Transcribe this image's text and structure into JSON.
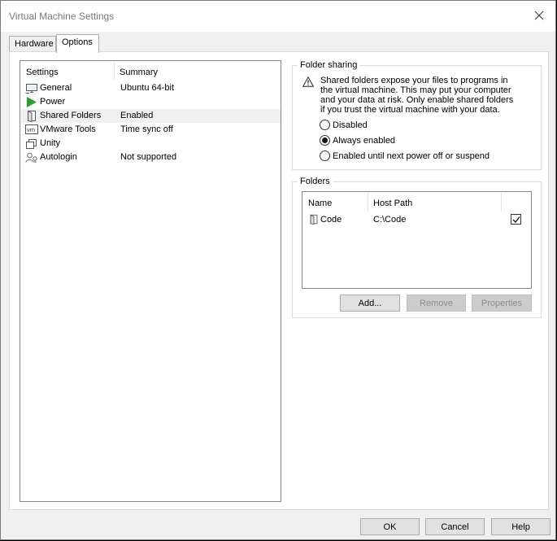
{
  "window": {
    "title": "Virtual Machine Settings"
  },
  "tabs": [
    {
      "label": "Hardware",
      "active": false
    },
    {
      "label": "Options",
      "active": true
    }
  ],
  "settings_list": {
    "headers": {
      "setting": "Settings",
      "summary": "Summary"
    },
    "rows": [
      {
        "icon": "monitor-icon",
        "label": "General",
        "summary": "Ubuntu 64-bit",
        "selected": false
      },
      {
        "icon": "power-play-icon",
        "label": "Power",
        "summary": "",
        "selected": false
      },
      {
        "icon": "shared-folder-icon",
        "label": "Shared Folders",
        "summary": "Enabled",
        "selected": true
      },
      {
        "icon": "vmware-tools-icon",
        "label": "VMware Tools",
        "summary": "Time sync off",
        "selected": false
      },
      {
        "icon": "unity-icon",
        "label": "Unity",
        "summary": "",
        "selected": false
      },
      {
        "icon": "autologin-icon",
        "label": "Autologin",
        "summary": "Not supported",
        "selected": false
      }
    ]
  },
  "folder_sharing": {
    "label": "Folder sharing",
    "warning_icon": "warning-icon",
    "warning_text": "Shared folders expose your files to programs in the virtual machine. This may put your computer and your data at risk. Only enable shared folders if you trust the virtual machine with your data.",
    "options": [
      {
        "label": "Disabled",
        "checked": false
      },
      {
        "label": "Always enabled",
        "checked": true
      },
      {
        "label": "Enabled until next power off or suspend",
        "checked": false
      }
    ]
  },
  "folders": {
    "label": "Folders",
    "columns": {
      "name": "Name",
      "host_path": "Host Path"
    },
    "rows": [
      {
        "icon": "shared-folder-icon",
        "name": "Code",
        "host_path": "C:\\Code",
        "enabled": true
      }
    ],
    "buttons": {
      "add": "Add...",
      "remove": "Remove",
      "properties": "Properties"
    }
  },
  "footer": {
    "ok": "OK",
    "cancel": "Cancel",
    "help": "Help"
  }
}
